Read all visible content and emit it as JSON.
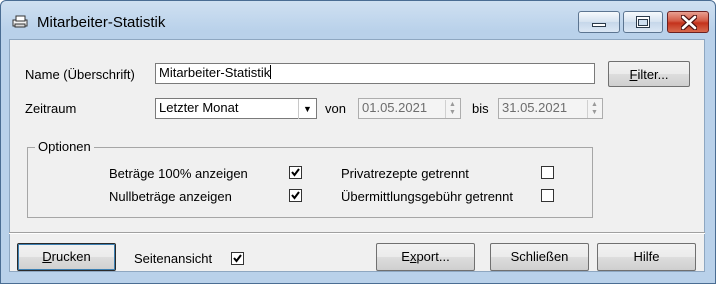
{
  "window": {
    "title": "Mitarbeiter-Statistik"
  },
  "form": {
    "name_label": "Name (Überschrift)",
    "name_value": "Mitarbeiter-Statistik",
    "filter_button_pre": "",
    "filter_button_accel": "F",
    "filter_button_post": "ilter...",
    "period_label": "Zeitraum",
    "period_value": "Letzter Monat",
    "from_label": "von",
    "from_value": "01.05.2021",
    "to_label": "bis",
    "to_value": "31.05.2021"
  },
  "options": {
    "group_label": "Optionen",
    "items": [
      {
        "label": "Beträge 100% anzeigen",
        "checked": true
      },
      {
        "label": "Nullbeträge anzeigen",
        "checked": true
      },
      {
        "label": "Privatrezepte getrennt",
        "checked": false
      },
      {
        "label": "Übermittlungsgebühr getrennt",
        "checked": false
      }
    ]
  },
  "footer": {
    "print_accel": "D",
    "print_rest": "rucken",
    "preview_label": "Seitenansicht",
    "preview_checked": true,
    "export_pre": "E",
    "export_accel": "x",
    "export_post": "port...",
    "close_label": "Schließen",
    "help_label": "Hilfe"
  },
  "colors": {
    "window_border": "#4a6d93",
    "client_bg": "#f0f0f0",
    "close_button": "#c4321c"
  }
}
